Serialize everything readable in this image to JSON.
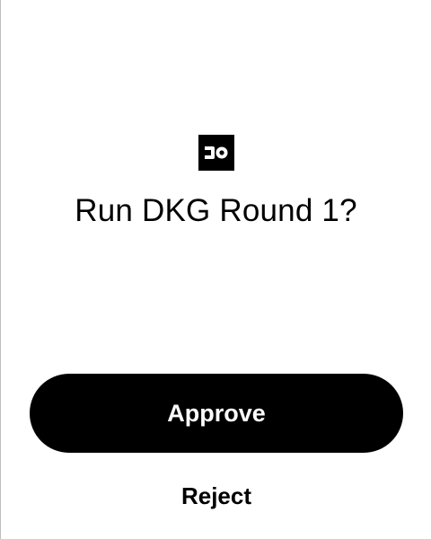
{
  "dialog": {
    "logo_icon": "10x-logo-icon",
    "title": "Run DKG Round 1?",
    "approve_label": "Approve",
    "reject_label": "Reject"
  },
  "colors": {
    "background": "#ffffff",
    "primary": "#000000",
    "primary_text": "#ffffff",
    "border": "#bdbdbd"
  }
}
